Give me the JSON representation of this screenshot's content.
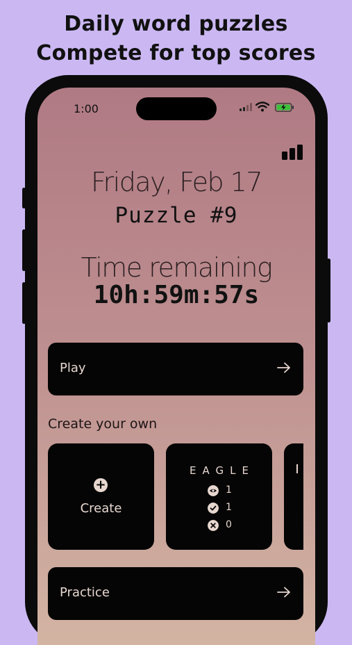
{
  "promo": {
    "line1": "Daily word puzzles",
    "line2": "Compete for top scores"
  },
  "status_bar": {
    "time": "1:00",
    "icons": [
      "cellular-signal-icon",
      "wifi-icon",
      "battery-charging-icon"
    ],
    "battery_color": "#3cc13b"
  },
  "header": {
    "stats_icon": "bar-chart-icon"
  },
  "puzzle": {
    "date": "Friday, Feb 17",
    "number": "Puzzle #9",
    "time_label": "Time remaining",
    "countdown": "10h:59m:57s"
  },
  "play_button": {
    "label": "Play",
    "icon": "arrow-right-icon"
  },
  "create_section": {
    "label": "Create your own",
    "create_card": {
      "label": "Create",
      "icon": "plus-circle-icon"
    },
    "puzzles": [
      {
        "word": "EAGLE",
        "stats": [
          {
            "icon": "eye-icon",
            "value": "1"
          },
          {
            "icon": "check-circle-icon",
            "value": "1"
          },
          {
            "icon": "x-circle-icon",
            "value": "0"
          }
        ]
      }
    ]
  },
  "practice_button": {
    "label": "Practice",
    "icon": "arrow-right-icon"
  },
  "colors": {
    "background": "#cbb8f3",
    "button_bg": "#050505",
    "button_text": "#e7d7cf",
    "gradient_top": "#b07a84",
    "gradient_bottom": "#d3b4a3"
  }
}
